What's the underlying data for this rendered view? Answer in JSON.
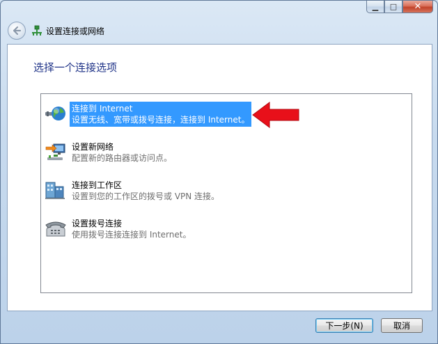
{
  "window": {
    "title": "设置连接或网络",
    "controls": {
      "minimize": "▁",
      "maximize": "□",
      "close": "✕"
    }
  },
  "nav": {
    "back_icon": "back-arrow-icon",
    "title_icon": "network-setup-icon"
  },
  "heading": "选择一个连接选项",
  "options": [
    {
      "title": "连接到 Internet",
      "desc": "设置无线、宽带或拨号连接，连接到 Internet。",
      "icon": "globe-icon",
      "selected": true
    },
    {
      "title": "设置新网络",
      "desc": "配置新的路由器或访问点。",
      "icon": "router-icon",
      "selected": false
    },
    {
      "title": "连接到工作区",
      "desc": "设置到您的工作区的拨号或 VPN 连接。",
      "icon": "workplace-icon",
      "selected": false
    },
    {
      "title": "设置拨号连接",
      "desc": "使用拨号连接连接到 Internet。",
      "icon": "telephone-icon",
      "selected": false
    }
  ],
  "buttons": {
    "next": "下一步(N)",
    "cancel": "取消"
  },
  "colors": {
    "selection": "#3399ff",
    "heading": "#1e3287",
    "annotation_arrow": "#e8101a"
  }
}
